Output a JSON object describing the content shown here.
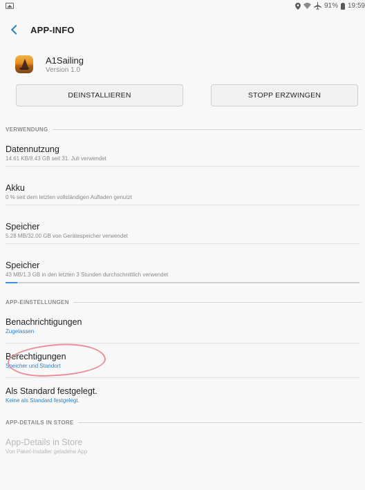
{
  "status": {
    "battery": "91%",
    "time": "19:59"
  },
  "header": {
    "title": "APP-INFO"
  },
  "app": {
    "name": "A1Sailing",
    "version": "Version 1.0"
  },
  "buttons": {
    "uninstall": "DEINSTALLIEREN",
    "force_stop": "STOPP ERZWINGEN"
  },
  "sections": {
    "usage": "VERWENDUNG",
    "settings": "APP-EINSTELLUNGEN",
    "store": "APP-DETAILS IN STORE"
  },
  "items": {
    "data_usage": {
      "title": "Datennutzung",
      "subtitle": "14.61 KB/8.43 GB seit 31. Juli verwendet"
    },
    "battery": {
      "title": "Akku",
      "subtitle": "0 % seit dem letzten vollständigen Aufladen genutzt"
    },
    "storage": {
      "title": "Speicher",
      "subtitle": "5.28 MB/32.00 GB von Gerätespeicher verwendet"
    },
    "memory": {
      "title": "Speicher",
      "subtitle": "43 MB/1.3 GB in den letzten 3 Stunden durchschnittlich verwendet",
      "progress_fraction": 0.033
    },
    "notifications": {
      "title": "Benachrichtigungen",
      "subtitle": "Zugelassen"
    },
    "permissions": {
      "title": "Berechtigungen",
      "subtitle": "Speicher und Standort"
    },
    "default": {
      "title": "Als Standard festgelegt.",
      "subtitle": "Keine als Standard festgelegt."
    },
    "store_details": {
      "title": "App-Details in Store",
      "subtitle": "Von Paket-Installer geladene App"
    }
  },
  "colors": {
    "accent": "#2e82c6",
    "annotation": "#ec8e99"
  }
}
